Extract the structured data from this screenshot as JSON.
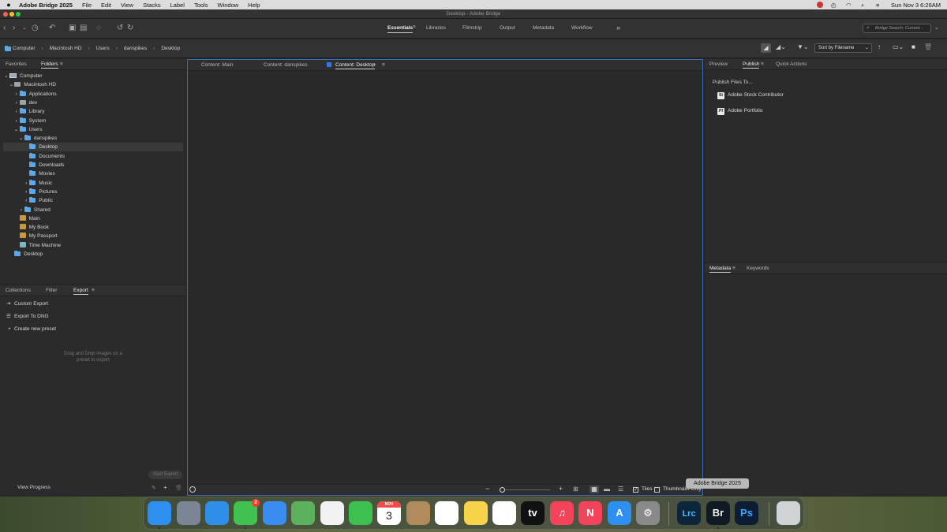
{
  "menubar": {
    "app_name": "Adobe Bridge 2025",
    "items": [
      "File",
      "Edit",
      "View",
      "Stacks",
      "Label",
      "Tools",
      "Window",
      "Help"
    ],
    "clock": "Sun Nov 3  6:26AM"
  },
  "window": {
    "title": "Desktop - Adobe Bridge"
  },
  "workspaces": {
    "tabs": [
      "Essentials",
      "Libraries",
      "Filmstrip",
      "Output",
      "Metadata",
      "Workflow"
    ],
    "active": "Essentials",
    "more": "»"
  },
  "search": {
    "placeholder": "Bridge Search: Current..."
  },
  "breadcrumb": [
    "Computer",
    "Macintosh HD",
    "Users",
    "danspikes",
    "Desktop"
  ],
  "sort": {
    "label": "Sort by Filename"
  },
  "left_top": {
    "tabs": [
      "Favorites",
      "Folders"
    ],
    "active": "Folders",
    "tree": [
      {
        "label": "Computer",
        "level": 0,
        "chevron": "down",
        "icon": "computer-icon"
      },
      {
        "label": "Macintosh HD",
        "level": 1,
        "chevron": "down",
        "icon": "hard-drive-icon"
      },
      {
        "label": "Applications",
        "level": 2,
        "chevron": "right",
        "icon": "folder-icon"
      },
      {
        "label": "dev",
        "level": 2,
        "chevron": "right",
        "icon": "hard-drive-icon"
      },
      {
        "label": "Library",
        "level": 2,
        "chevron": "right",
        "icon": "folder-icon"
      },
      {
        "label": "System",
        "level": 2,
        "chevron": "right",
        "icon": "folder-icon"
      },
      {
        "label": "Users",
        "level": 2,
        "chevron": "down",
        "icon": "folder-icon"
      },
      {
        "label": "danspikes",
        "level": 3,
        "chevron": "down",
        "icon": "folder-icon"
      },
      {
        "label": "Desktop",
        "level": 4,
        "chevron": "",
        "icon": "folder-icon",
        "selected": true
      },
      {
        "label": "Documents",
        "level": 4,
        "chevron": "",
        "icon": "folder-icon"
      },
      {
        "label": "Downloads",
        "level": 4,
        "chevron": "",
        "icon": "folder-icon"
      },
      {
        "label": "Movies",
        "level": 4,
        "chevron": "",
        "icon": "folder-icon"
      },
      {
        "label": "Music",
        "level": 4,
        "chevron": "right",
        "icon": "folder-icon"
      },
      {
        "label": "Pictures",
        "level": 4,
        "chevron": "right",
        "icon": "folder-icon"
      },
      {
        "label": "Public",
        "level": 4,
        "chevron": "right",
        "icon": "folder-icon"
      },
      {
        "label": "Shared",
        "level": 3,
        "chevron": "right",
        "icon": "folder-icon"
      },
      {
        "label": "Main",
        "level": 2,
        "chevron": "",
        "icon": "external-drive-icon"
      },
      {
        "label": "My Book",
        "level": 2,
        "chevron": "",
        "icon": "external-drive-icon"
      },
      {
        "label": "My Passport",
        "level": 2,
        "chevron": "",
        "icon": "external-drive-icon"
      },
      {
        "label": "Time Machine",
        "level": 2,
        "chevron": "",
        "icon": "time-machine-icon"
      },
      {
        "label": "Desktop",
        "level": 1,
        "chevron": "",
        "icon": "folder-icon"
      }
    ]
  },
  "left_bottom": {
    "tabs": [
      "Collections",
      "Filter",
      "Export"
    ],
    "active": "Export",
    "items": [
      {
        "label": "Custom Export",
        "icon": "export-icon"
      },
      {
        "label": "Export To DNG",
        "icon": "list-icon"
      },
      {
        "label": "Create new preset",
        "icon": "plus-icon"
      }
    ],
    "hint": "Drag and Drop images on a preset to export",
    "start_export": "Start Export",
    "view_progress": "View Progress"
  },
  "content": {
    "tabs": [
      "Content: Main",
      "Content: danspikes",
      "Content: Desktop"
    ],
    "active": "Content: Desktop",
    "tiles_label": "Tiles",
    "thumbnails_label": "Thumbnails Only",
    "tiles_checked": true,
    "thumbnails_checked": false,
    "zoom_level": 0.05
  },
  "right_top": {
    "tabs": [
      "Preview",
      "Publish",
      "Quick Actions"
    ],
    "active": "Publish",
    "heading": "Publish Files To...",
    "items": [
      {
        "badge": "St",
        "label": "Adobe Stock Contributor"
      },
      {
        "badge": "Pf",
        "label": "Adobe Portfolio"
      }
    ]
  },
  "right_bottom": {
    "tabs": [
      "Metadata",
      "Keywords"
    ],
    "active": "Metadata"
  },
  "tooltip": "Adobe Bridge 2025",
  "dock": {
    "apps": [
      {
        "name": "finder-icon",
        "text": "",
        "color": "#2d8ff0"
      },
      {
        "name": "launchpad-icon",
        "text": "",
        "color": "#7a8596"
      },
      {
        "name": "safari-icon",
        "text": "",
        "color": "#2f8ee8"
      },
      {
        "name": "messages-icon",
        "text": "",
        "color": "#3fc24f"
      },
      {
        "name": "mail-icon",
        "text": "",
        "color": "#3b8cf0"
      },
      {
        "name": "maps-icon",
        "text": "",
        "color": "#5cb25c"
      },
      {
        "name": "photos-icon",
        "text": "",
        "color": "#f2f2f2"
      },
      {
        "name": "facetime-icon",
        "text": "",
        "color": "#3cc150"
      },
      {
        "name": "calendar-icon",
        "text": "3",
        "color": "#ffffff"
      },
      {
        "name": "contacts-icon",
        "text": "",
        "color": "#b08a5a"
      },
      {
        "name": "reminders-icon",
        "text": "",
        "color": "#ffffff"
      },
      {
        "name": "notes-icon",
        "text": "",
        "color": "#f7d44a"
      },
      {
        "name": "freeform-icon",
        "text": "",
        "color": "#ffffff"
      },
      {
        "name": "appletv-icon",
        "text": "tv",
        "color": "#111111"
      },
      {
        "name": "music-icon",
        "text": "♫",
        "color": "#f2435a"
      },
      {
        "name": "news-icon",
        "text": "N",
        "color": "#f2435a"
      },
      {
        "name": "appstore-icon",
        "text": "A",
        "color": "#2d8ff0"
      },
      {
        "name": "settings-icon",
        "text": "⚙",
        "color": "#8a8a8a"
      },
      {
        "name": "lightroom-classic-icon",
        "text": "Lrc",
        "color": "#0c2538"
      },
      {
        "name": "bridge-icon",
        "text": "Br",
        "color": "#0f1a24"
      },
      {
        "name": "photoshop-icon",
        "text": "Ps",
        "color": "#0b1c33"
      },
      {
        "name": "trash-icon",
        "text": "",
        "color": "#cfd3d6"
      }
    ],
    "calendar_month": "NOV",
    "messages_badge": "2"
  }
}
